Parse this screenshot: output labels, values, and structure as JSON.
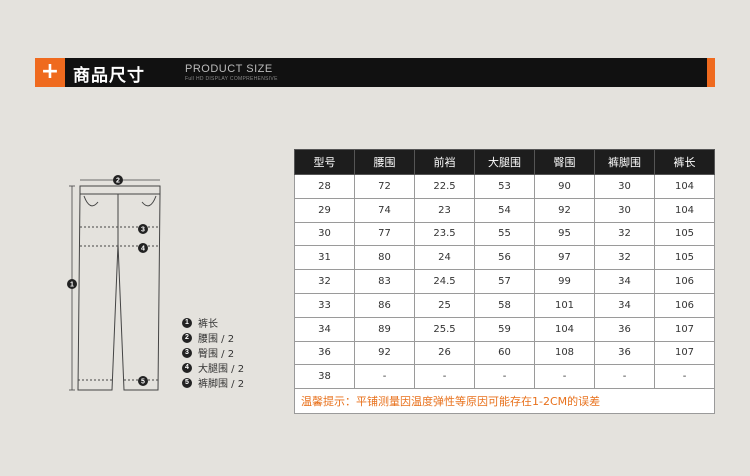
{
  "header": {
    "plus_symbol": "+",
    "title_cn": "商品尺寸",
    "title_en": "PRODUCT SIZE",
    "subtitle_en": "Full HD DISPLAY COMPREHENSIVE",
    "accent_color": "#ef6a1e"
  },
  "diagram": {
    "markers": [
      "1",
      "2",
      "3",
      "4",
      "5"
    ]
  },
  "legend": [
    {
      "num": "1",
      "label": "裤长"
    },
    {
      "num": "2",
      "label": "腰围 / 2"
    },
    {
      "num": "3",
      "label": "臀围 / 2"
    },
    {
      "num": "4",
      "label": "大腿围 / 2"
    },
    {
      "num": "5",
      "label": "裤脚围 / 2"
    }
  ],
  "table": {
    "headers": [
      "型号",
      "腰围",
      "前裆",
      "大腿围",
      "臀围",
      "裤脚围",
      "裤长"
    ],
    "rows": [
      [
        "28",
        "72",
        "22.5",
        "53",
        "90",
        "30",
        "104"
      ],
      [
        "29",
        "74",
        "23",
        "54",
        "92",
        "30",
        "104"
      ],
      [
        "30",
        "77",
        "23.5",
        "55",
        "95",
        "32",
        "105"
      ],
      [
        "31",
        "80",
        "24",
        "56",
        "97",
        "32",
        "105"
      ],
      [
        "32",
        "83",
        "24.5",
        "57",
        "99",
        "34",
        "106"
      ],
      [
        "33",
        "86",
        "25",
        "58",
        "101",
        "34",
        "106"
      ],
      [
        "34",
        "89",
        "25.5",
        "59",
        "104",
        "36",
        "107"
      ],
      [
        "36",
        "92",
        "26",
        "60",
        "108",
        "36",
        "107"
      ],
      [
        "38",
        "-",
        "-",
        "-",
        "-",
        "-",
        "-"
      ]
    ],
    "note": "温馨提示：平铺测量因温度弹性等原因可能存在1-2CM的误差"
  }
}
